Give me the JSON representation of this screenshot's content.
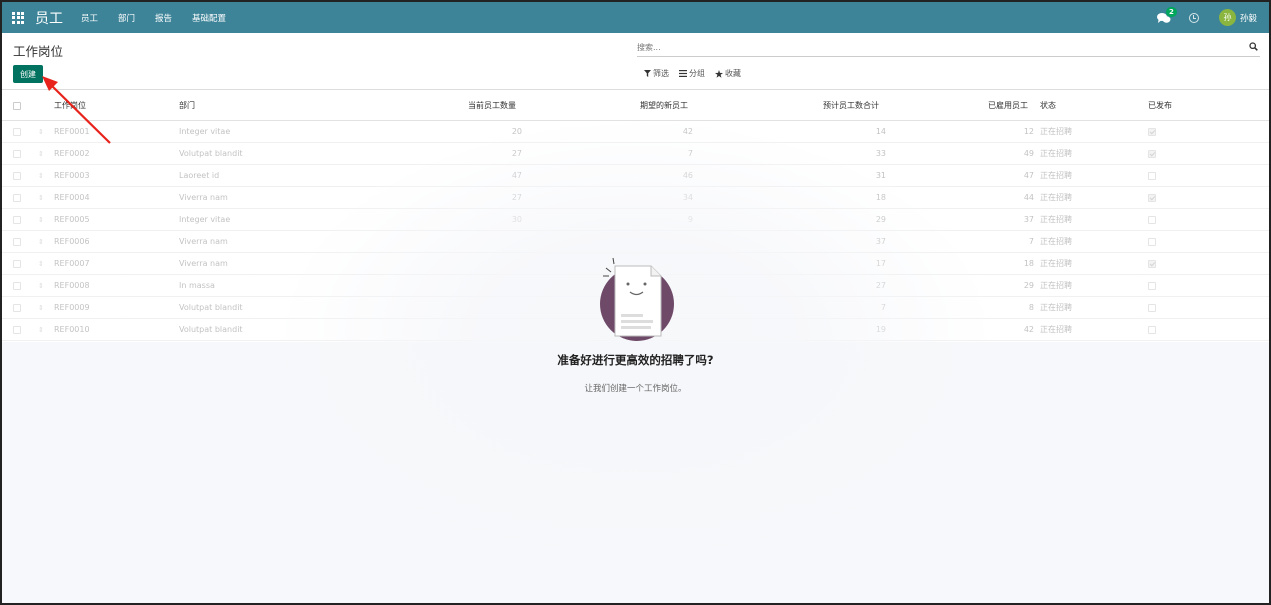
{
  "navbar": {
    "app_title": "员工",
    "menu": [
      "员工",
      "部门",
      "报告",
      "基础配置"
    ],
    "chat_count": "2",
    "user_initial": "孙",
    "user_name": "孙毅"
  },
  "control_panel": {
    "title": "工作岗位",
    "create_label": "创建",
    "search_placeholder": "搜索...",
    "filters_label": "筛选",
    "groupby_label": "分组",
    "favorites_label": "收藏"
  },
  "table": {
    "headers": [
      "工作岗位",
      "部门",
      "当前员工数量",
      "期望的新员工",
      "预计员工数合计",
      "已雇用员工",
      "状态",
      "已发布"
    ],
    "rows": [
      {
        "name": "REF0001",
        "dept": "Integer vitae",
        "current": "20",
        "expected": "42",
        "total": "14",
        "hired": "12",
        "state": "正在招聘",
        "published": true
      },
      {
        "name": "REF0002",
        "dept": "Volutpat blandit",
        "current": "27",
        "expected": "7",
        "total": "33",
        "hired": "49",
        "state": "正在招聘",
        "published": true
      },
      {
        "name": "REF0003",
        "dept": "Laoreet id",
        "current": "47",
        "expected": "46",
        "total": "31",
        "hired": "47",
        "state": "正在招聘",
        "published": false
      },
      {
        "name": "REF0004",
        "dept": "Viverra nam",
        "current": "27",
        "expected": "34",
        "total": "18",
        "hired": "44",
        "state": "正在招聘",
        "published": true
      },
      {
        "name": "REF0005",
        "dept": "Integer vitae",
        "current": "30",
        "expected": "9",
        "total": "29",
        "hired": "37",
        "state": "正在招聘",
        "published": false
      },
      {
        "name": "REF0006",
        "dept": "Viverra nam",
        "current": "",
        "expected": "",
        "total": "37",
        "hired": "7",
        "state": "正在招聘",
        "published": false
      },
      {
        "name": "REF0007",
        "dept": "Viverra nam",
        "current": "",
        "expected": "",
        "total": "17",
        "hired": "18",
        "state": "正在招聘",
        "published": true
      },
      {
        "name": "REF0008",
        "dept": "In massa",
        "current": "",
        "expected": "",
        "total": "27",
        "hired": "29",
        "state": "正在招聘",
        "published": false
      },
      {
        "name": "REF0009",
        "dept": "Volutpat blandit",
        "current": "",
        "expected": "",
        "total": "7",
        "hired": "8",
        "state": "正在招聘",
        "published": false
      },
      {
        "name": "REF0010",
        "dept": "Volutpat blandit",
        "current": "",
        "expected": "",
        "total": "19",
        "hired": "42",
        "state": "正在招聘",
        "published": false
      }
    ]
  },
  "helper": {
    "title": "准备好进行更高效的招聘了吗?",
    "subtitle": "让我们创建一个工作岗位。"
  },
  "colors": {
    "navbar": "#3d8499",
    "primary_button": "#00725f",
    "annotation_arrow": "#e8231b"
  }
}
